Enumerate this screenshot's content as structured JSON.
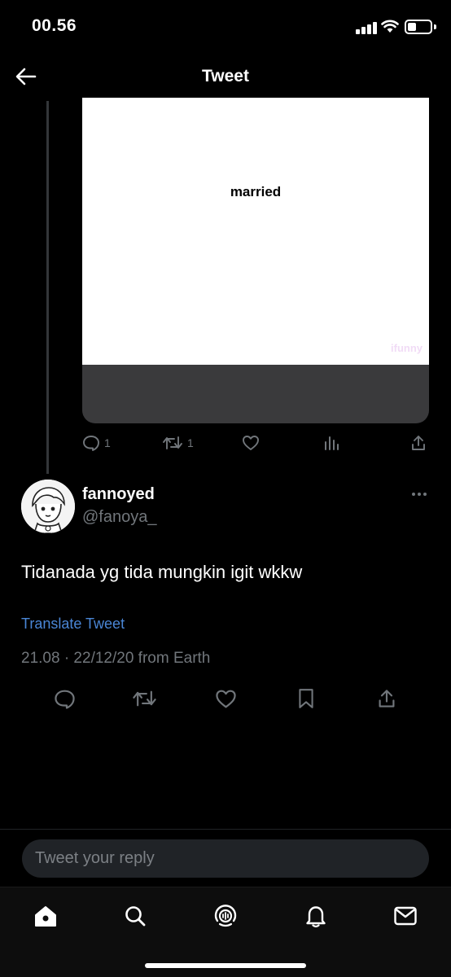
{
  "status_bar": {
    "time": "00.56"
  },
  "header": {
    "title": "Tweet"
  },
  "parent_tweet": {
    "media_caption": "married",
    "media_watermark": "ifunny",
    "reply_count": "1",
    "retweet_count": "1"
  },
  "tweet": {
    "display_name": "fannoyed",
    "handle": "@fanoya_",
    "text": "Tidanada yg tida mungkin igit wkkw",
    "translate_label": "Translate Tweet",
    "meta": "21.08 · 22/12/20 from Earth"
  },
  "reply": {
    "placeholder": "Tweet your reply"
  },
  "colors": {
    "link": "#4a86d6",
    "muted": "#71767b",
    "background": "#000000"
  },
  "icons": {
    "nav": [
      "home-icon",
      "search-icon",
      "spaces-icon",
      "notifications-icon",
      "messages-icon"
    ],
    "actions": [
      "reply-icon",
      "retweet-icon",
      "like-icon",
      "bookmark-icon",
      "share-icon"
    ]
  }
}
